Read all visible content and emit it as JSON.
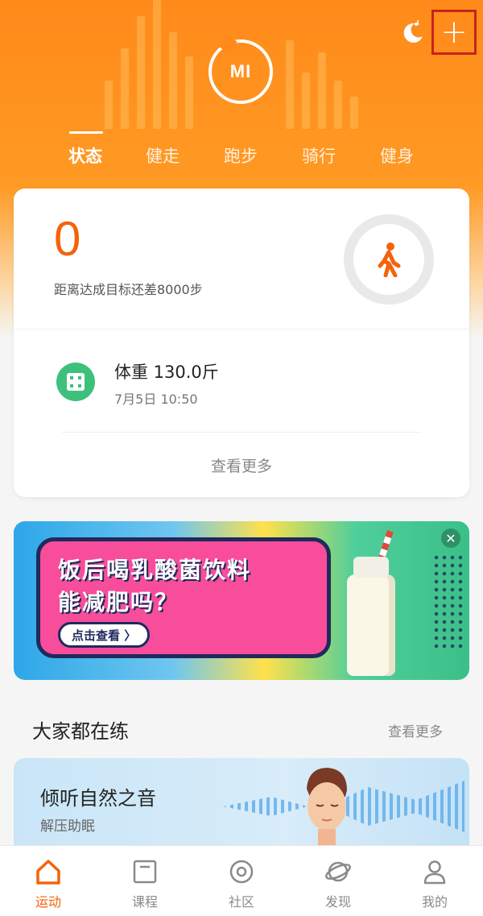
{
  "header": {
    "logo_text": "MI",
    "moon_icon": "moon-music-icon",
    "add_icon": "plus-icon"
  },
  "tabs": [
    {
      "label": "状态",
      "active": true
    },
    {
      "label": "健走",
      "active": false
    },
    {
      "label": "跑步",
      "active": false
    },
    {
      "label": "骑行",
      "active": false
    },
    {
      "label": "健身",
      "active": false
    }
  ],
  "status_card": {
    "steps": "0",
    "goal_text": "距离达成目标还差8000步",
    "activity_icon": "walking-person-icon",
    "weight": {
      "title": "体重 130.0斤",
      "time": "7月5日 10:50",
      "icon": "scale-icon"
    },
    "more_label": "查看更多"
  },
  "banner": {
    "title_line1": "饭后喝乳酸菌饮料",
    "title_line2": "能减肥吗？",
    "button_label": "点击查看 〉",
    "close_label": "✕"
  },
  "practice_section": {
    "title": "大家都在练",
    "more_label": "查看更多",
    "course": {
      "title": "倾听自然之音",
      "subtitle": "解压助眠"
    }
  },
  "bottom_nav": [
    {
      "label": "运动",
      "icon": "home-icon",
      "active": true
    },
    {
      "label": "课程",
      "icon": "course-icon",
      "active": false
    },
    {
      "label": "社区",
      "icon": "community-icon",
      "active": false
    },
    {
      "label": "发现",
      "icon": "discover-icon",
      "active": false
    },
    {
      "label": "我的",
      "icon": "profile-icon",
      "active": false
    }
  ],
  "colors": {
    "accent": "#f5620c",
    "header_orange": "#ff8a1a",
    "green": "#3dc17a"
  }
}
